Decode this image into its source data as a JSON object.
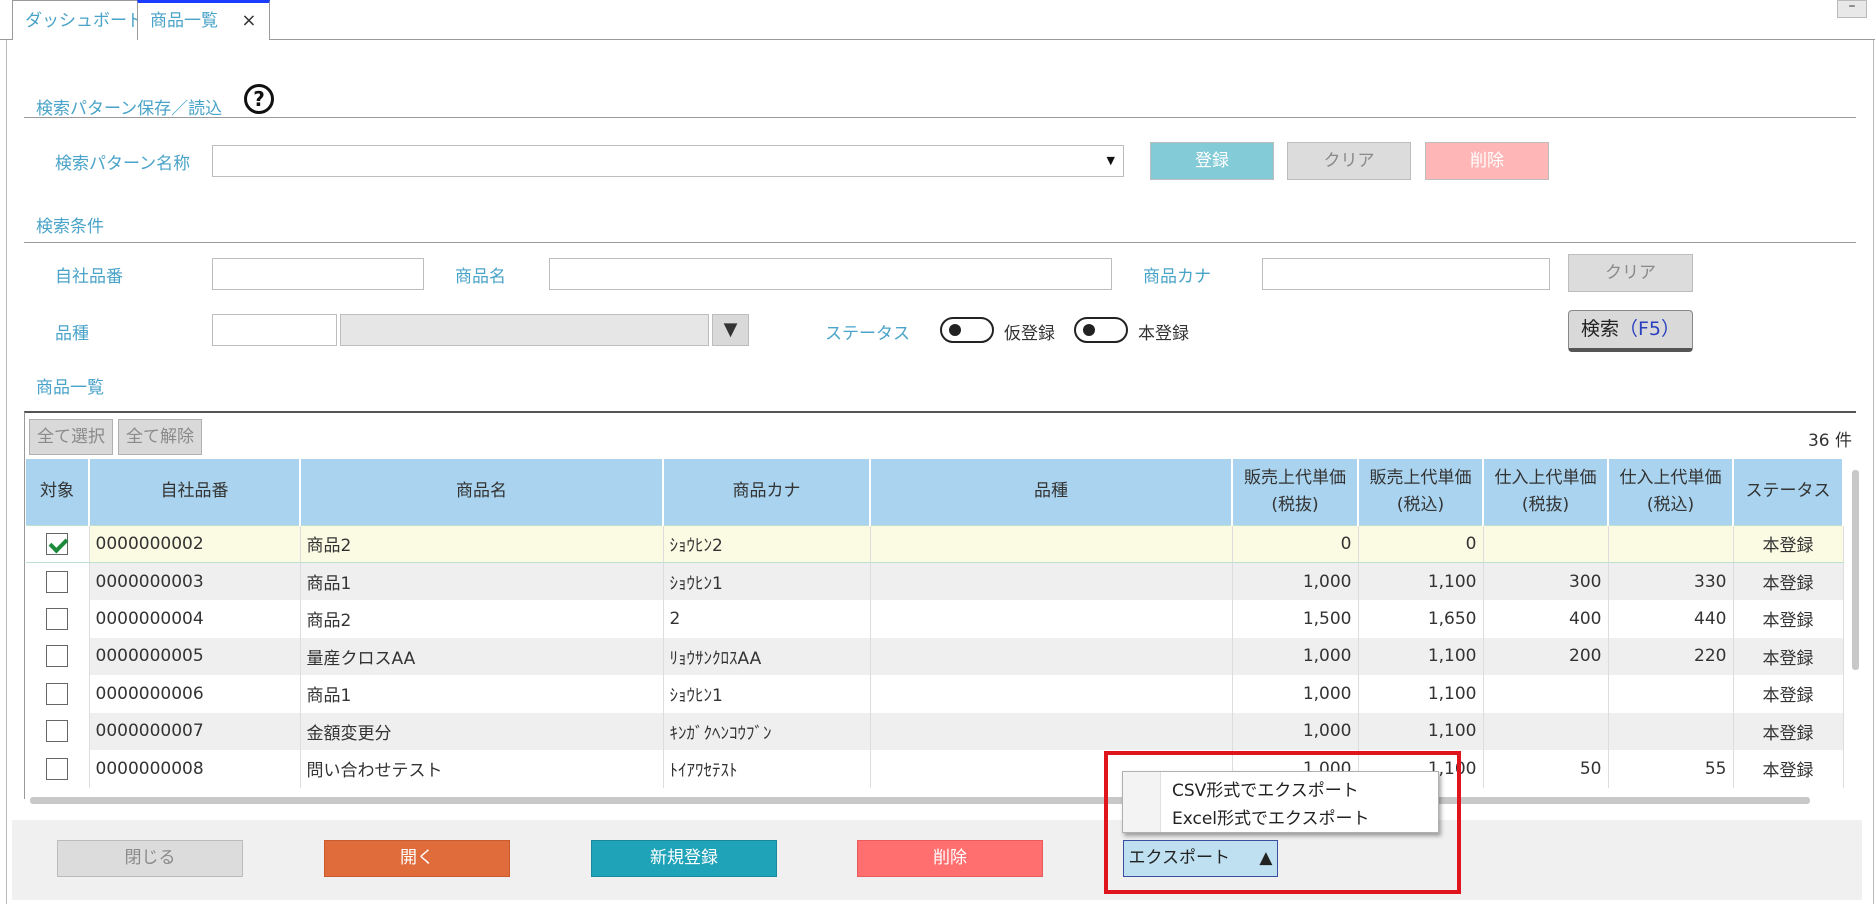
{
  "tabs": [
    {
      "label": "ダッシュボード"
    },
    {
      "label": "商品一覧",
      "close": "×"
    }
  ],
  "window_min": "–",
  "search_pattern": {
    "title": "検索パターン保存／読込",
    "help": "?",
    "name_label": "検索パターン名称",
    "name_value": "",
    "register": "登録",
    "clear": "クリア",
    "delete": "削除"
  },
  "conditions": {
    "title": "検索条件",
    "code_label": "自社品番",
    "name_label": "商品名",
    "kana_label": "商品カナ",
    "clear": "クリア",
    "type_label": "品種",
    "status_label": "ステータス",
    "status_opt1": "仮登録",
    "status_opt2": "本登録",
    "search_btn": "検索",
    "search_key": "（F5）",
    "dropdown_arrow": "▼"
  },
  "list": {
    "title": "商品一覧",
    "select_all": "全て選択",
    "deselect_all": "全て解除",
    "count": "36 件",
    "columns": [
      "対象",
      "自社品番",
      "商品名",
      "商品カナ",
      "品種",
      "販売上代単価",
      "(税抜)",
      "販売上代単価",
      "(税込)",
      "仕入上代単価",
      "(税抜)",
      "仕入上代単価",
      "(税込)",
      "ステータス"
    ],
    "rows": [
      {
        "checked": true,
        "code": "0000000002",
        "name": "商品2",
        "kana": "ｼｮｳﾋﾝ2",
        "type": "",
        "p1": "0",
        "p2": "0",
        "p3": "",
        "p4": "",
        "status": "本登録"
      },
      {
        "checked": false,
        "code": "0000000003",
        "name": "商品1",
        "kana": "ｼｮｳﾋﾝ1",
        "type": "",
        "p1": "1,000",
        "p2": "1,100",
        "p3": "300",
        "p4": "330",
        "status": "本登録"
      },
      {
        "checked": false,
        "code": "0000000004",
        "name": "商品2",
        "kana": "2",
        "type": "",
        "p1": "1,500",
        "p2": "1,650",
        "p3": "400",
        "p4": "440",
        "status": "本登録"
      },
      {
        "checked": false,
        "code": "0000000005",
        "name": "量産クロスAA",
        "kana": "ﾘｮｳｻﾝｸﾛｽAA",
        "type": "",
        "p1": "1,000",
        "p2": "1,100",
        "p3": "200",
        "p4": "220",
        "status": "本登録"
      },
      {
        "checked": false,
        "code": "0000000006",
        "name": "商品1",
        "kana": "ｼｮｳﾋﾝ1",
        "type": "",
        "p1": "1,000",
        "p2": "1,100",
        "p3": "",
        "p4": "",
        "status": "本登録"
      },
      {
        "checked": false,
        "code": "0000000007",
        "name": "金額変更分",
        "kana": "ｷﾝｶﾞｸﾍﾝｺｳﾌﾞﾝ",
        "type": "",
        "p1": "1,000",
        "p2": "1,100",
        "p3": "",
        "p4": "",
        "status": "本登録"
      },
      {
        "checked": false,
        "code": "0000000008",
        "name": "問い合わせテスト",
        "kana": "ﾄｲｱﾜｾﾃｽﾄ",
        "type": "",
        "p1": "1,000",
        "p2": "1,100",
        "p3": "50",
        "p4": "55",
        "status": "本登録"
      }
    ]
  },
  "footer": {
    "close": "閉じる",
    "open": "開く",
    "new": "新規登録",
    "delete": "削除",
    "export": "エクスポート",
    "export_arrow": "▲"
  },
  "export_menu": {
    "csv": "CSV形式でエクスポート",
    "excel": "Excel形式でエクスポート"
  },
  "colors": {
    "accent_label": "#4aa3c8",
    "header_bg": "#a9d3ee",
    "open_btn": "#e06c3c",
    "new_btn": "#1fa3b8",
    "delete_btn": "#ff6f6f",
    "highlight_box": "#e0141c"
  }
}
